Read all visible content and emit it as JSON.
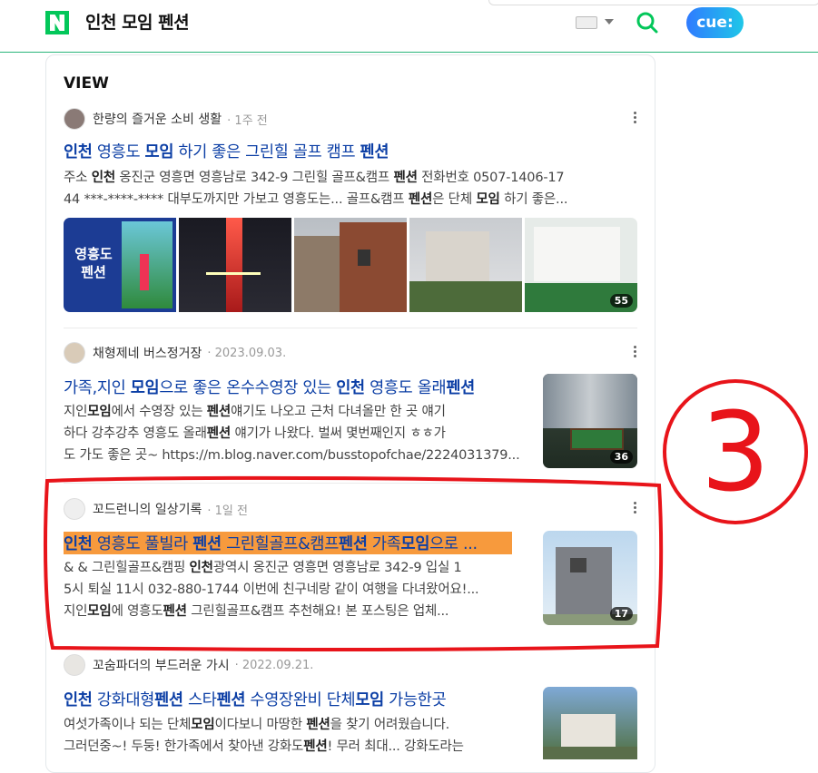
{
  "header": {
    "query": "인천 모임 펜션",
    "cue_label": "cue:"
  },
  "section": {
    "title": "VIEW"
  },
  "posts": [
    {
      "author": "한량의 즐거운 소비 생활",
      "date": "1주 전",
      "title_parts": [
        "인천",
        " 영흥도 ",
        "모임",
        " 하기 좋은 그린힐 골프 캠프 ",
        "펜션"
      ],
      "desc_lines": [
        [
          "주소 ",
          "인천",
          " 옹진군 영흥면 영흥남로 342-9 그린힐 골프&캠프 ",
          "펜션",
          " 전화번호 0507-1406-17"
        ],
        [
          "44 ***-****-**** 대부도까지만 가보고 영흥도는... 골프&캠프 ",
          "펜션",
          "은 단체 ",
          "모임",
          " 하기 좋은..."
        ]
      ],
      "images": [
        "golf-poster",
        "bridge-night",
        "brick-building",
        "white-building",
        "screen-golf"
      ],
      "image_count": "55",
      "poster_text": [
        "영흥도",
        "펜션"
      ]
    },
    {
      "author": "채형제네 버스정거장",
      "date": "2023.09.03.",
      "title_parts": [
        "가족,지인 ",
        "모임",
        "으로 좋은 온수수영장 있는 ",
        "인천",
        " 영흥도 올래",
        "펜션"
      ],
      "desc_lines": [
        [
          "지인",
          "모임",
          "에서 수영장 있는 ",
          "펜션",
          "얘기도 나오고 근처 다녀올만 한 곳 얘기"
        ],
        [
          "하다 강추강추 영흥도 올래",
          "펜션",
          " 얘기가 나왔다. 벌써 몇번째인지 ㅎㅎ가"
        ],
        [
          "도 가도 좋은 곳~ https://m.blog.naver.com/busstopofchae/2224031379..."
        ]
      ],
      "image_count": "36"
    },
    {
      "author": "꼬드런니의 일상기록",
      "date": "1일 전",
      "title_parts": [
        "인천",
        " 영흥도 풀빌라 ",
        "펜션",
        " 그린힐골프&캠프",
        "펜션",
        " 가족",
        "모임",
        "으로 ..."
      ],
      "desc_lines": [
        [
          "& & 그린힐골프&캠핑 ",
          "인천",
          "광역시 옹진군 영흥면 영흥남로 342-9 입실 1"
        ],
        [
          "5시 퇴실 11시 032-880-1744 이번에 친구네랑 같이 여행을 다녀왔어요!..."
        ],
        [
          "지인",
          "모임",
          "에 영흥도",
          "펜션",
          " 그린힐골프&캠프 추천해요! 본 포스팅은 업체..."
        ]
      ],
      "image_count": "17"
    },
    {
      "author": "꼬숨파더의 부드러운 가시",
      "date": "2022.09.21.",
      "title_parts": [
        "인천",
        " 강화대형",
        "펜션",
        " 스타",
        "펜션",
        " 수영장완비 단체",
        "모임",
        " 가능한곳"
      ],
      "desc_lines": [
        [
          "여섯가족이나 되는 단체",
          "모임",
          "이다보니 마땅한 ",
          "펜션",
          "을 찾기 어려웠습니다."
        ],
        [
          "그러던중~! 두둥! 한가족에서 찾아낸 강화도",
          "펜션",
          "! 무러 최대... 강화도라는"
        ]
      ]
    }
  ],
  "annotation": {
    "number_label": "3",
    "color": "#e8141a"
  },
  "colors": {
    "accent": "#03c75a",
    "link": "#0b3ea5",
    "highlight": "#f79a3d"
  }
}
